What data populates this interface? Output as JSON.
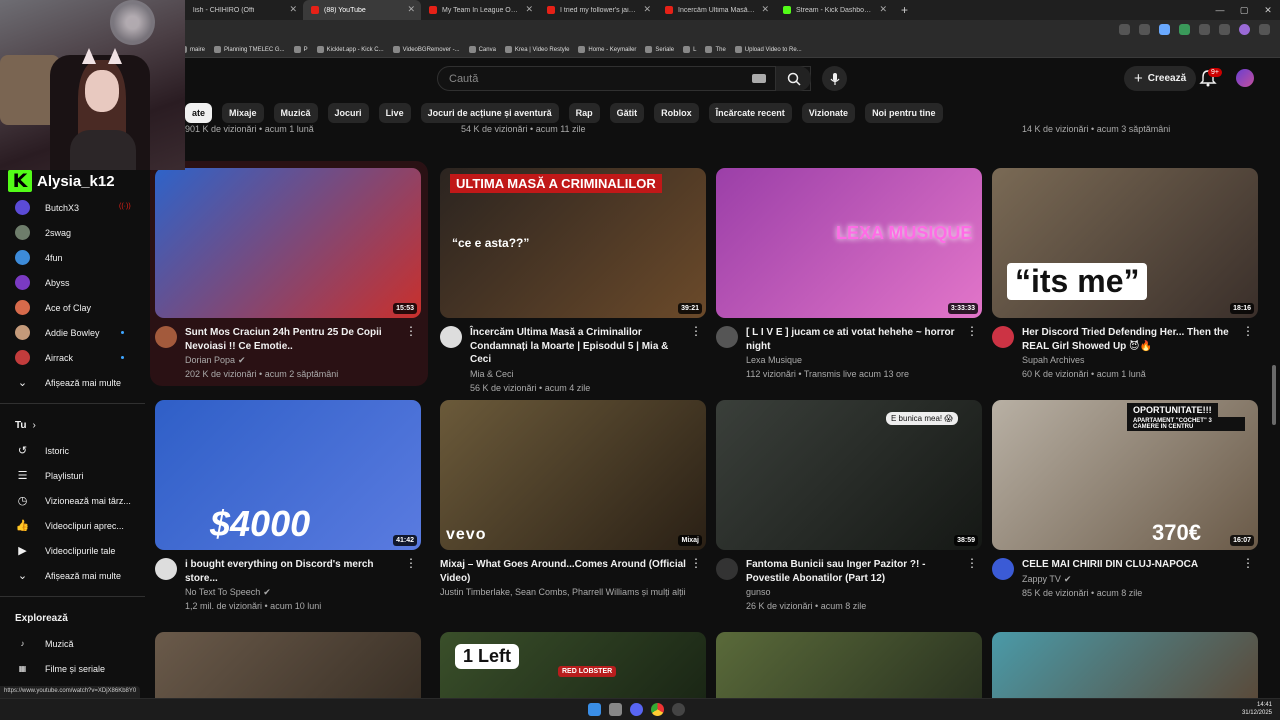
{
  "browser": {
    "tabs": [
      {
        "label": "lish - CHIHIRO (Offi",
        "active": false
      },
      {
        "label": "(88) YouTube",
        "active": true
      },
      {
        "label": "My Team In League Of Legends",
        "active": false
      },
      {
        "label": "I tried my follower's jail-worthy",
        "active": false
      },
      {
        "label": "Încercăm Ultima Masă a Crimin",
        "active": false
      },
      {
        "label": "Stream - Kick Dashboard",
        "active": false
      }
    ],
    "bookmarks": [
      "maire",
      "Planning TMELEC G...",
      "P",
      "Kicklet.app - Kick C...",
      "VideoBGRemover -...",
      "Canva",
      "Krea | Video Restyle",
      "Home - Keymailer",
      "Seriale",
      "L",
      "The",
      "Upload Video to Re..."
    ],
    "status_url": "https://www.youtube.com/watch?v=XDjX86Kb8Y0"
  },
  "overlay": {
    "streamer_name": "Alysia_k12",
    "kick_glyph": "K"
  },
  "header": {
    "search_placeholder": "Caută",
    "create_label": "Creează",
    "notif_count": "9+"
  },
  "chips": [
    "ate",
    "Mixaje",
    "Muzică",
    "Jocuri",
    "Live",
    "Jocuri de acțiune și aventură",
    "Rap",
    "Gătit",
    "Roblox",
    "Încărcate recent",
    "Vizionate",
    "Noi pentru tine"
  ],
  "sidebar": {
    "subscriptions": [
      {
        "name": "ButchX3",
        "color": "#5b4bd6",
        "live": "red"
      },
      {
        "name": "2swag",
        "color": "#6e7d6b",
        "live": ""
      },
      {
        "name": "4fun",
        "color": "#3d8bd9",
        "live": ""
      },
      {
        "name": "Abyss",
        "color": "#7a3ac2",
        "live": ""
      },
      {
        "name": "Ace of Clay",
        "color": "#d66a4b",
        "live": ""
      },
      {
        "name": "Addie Bowley",
        "color": "#c49a7a",
        "live": "blue"
      },
      {
        "name": "Airrack",
        "color": "#c23c3c",
        "live": "blue"
      }
    ],
    "show_more": "Afișează mai multe",
    "you_section": "Tu",
    "you_items": [
      {
        "label": "Istoric",
        "icon": "↺"
      },
      {
        "label": "Playlisturi",
        "icon": "☰"
      },
      {
        "label": "Vizionează mai târz...",
        "icon": "◷"
      },
      {
        "label": "Videoclipuri aprec...",
        "icon": "👍"
      },
      {
        "label": "Videoclipurile tale",
        "icon": "▶"
      }
    ],
    "show_more_2": "Afișează mai multe",
    "explore_section": "Explorează",
    "explore_items": [
      {
        "label": "Muzică",
        "icon": "♪"
      },
      {
        "label": "Filme și seriale",
        "icon": "▦"
      },
      {
        "label": "Live",
        "icon": "((·))"
      }
    ]
  },
  "top_strip": [
    "901 K de vizionări • acum 1 lună",
    "54 K de vizionări • acum 11 zile",
    "14 K de vizionări • acum 3 săptămâni"
  ],
  "videos": [
    {
      "title": "Sunt Mos Craciun 24h Pentru 25 De Copii Nevoiasi !! Ce Emotie..",
      "channel": "Dorian Popa",
      "stats": "202 K de vizionări • acum 2 săptămâni",
      "duration": "15:53",
      "verified": true,
      "thumb": [
        "#2e63c9",
        "#c9302c"
      ],
      "avatar": "#a35a3c"
    },
    {
      "title": "Încercăm Ultima Masă a Criminalilor Condamnați la Moarte | Episodul 5 | Mia & Ceci",
      "channel": "Mia & Ceci",
      "stats": "56 K de vizionări • acum 4 zile",
      "duration": "39:21",
      "thumb": [
        "#2b2420",
        "#6b4a2a"
      ],
      "avatar": "#ddd",
      "banner": "ULTIMA MASĂ A CRIMINALILOR",
      "quote": "“ce e asta??”"
    },
    {
      "title": "[ L I V E ] jucam ce ati votat hehehe ~ horror night",
      "channel": "Lexa Musique",
      "stats": "112 vizionări • Transmis live acum 13 ore",
      "duration": "3:33:33",
      "thumb": [
        "#9b3fa8",
        "#e275c9"
      ],
      "avatar": "#555",
      "overlay": "LEXA MUSIQUE"
    },
    {
      "title": "Her Discord Tried Defending Her... Then the REAL Girl Showed Up 😈🔥",
      "channel": "Supah Archives",
      "stats": "60 K de vizionări • acum 1 lună",
      "duration": "18:16",
      "thumb": [
        "#7a6a55",
        "#3a2f2a"
      ],
      "avatar": "#cc3344",
      "overlay": "“its me”"
    },
    {
      "title": "i bought everything on Discord's merch store...",
      "channel": "No Text To Speech",
      "stats": "1,2 mil. de vizionări • acum 10 luni",
      "duration": "41:42",
      "verified": true,
      "thumb": [
        "#2f5fc7",
        "#5a7be0"
      ],
      "avatar": "#ddd",
      "overlay": "$4000"
    },
    {
      "title": "Mixaj – What Goes Around...Comes Around (Official Video)",
      "channel": "Justin Timberlake, Sean Combs, Pharrell Williams și mulți alții",
      "stats": "",
      "duration": "Mixaj",
      "thumb": [
        "#6b5a3a",
        "#2a2015"
      ],
      "avatar": "",
      "overlay": "vevo"
    },
    {
      "title": "Fantoma Bunicii sau Inger Pazitor ?! - Povestile Abonatilor (Part 12)",
      "channel": "gunso",
      "stats": "26 K de vizionări • acum 8 zile",
      "duration": "38:59",
      "thumb": [
        "#3a3f3a",
        "#151815"
      ],
      "avatar": "#333",
      "overlay": "E bunica mea! 😱"
    },
    {
      "title": "CELE MAI CHIRII DIN CLUJ-NAPOCA",
      "channel": "Zappy TV",
      "stats": "85 K de vizionări • acum 8 zile",
      "duration": "16:07",
      "verified": true,
      "thumb": [
        "#b8b0a4",
        "#6a5a48"
      ],
      "avatar": "#3b5bd6",
      "overlay": "370€",
      "banner": "OPORTUNITATE!!!",
      "subbanner": "APARTAMENT \"COCHET\" 3 CAMERE IN CENTRU"
    }
  ],
  "row3": [
    {
      "thumb": [
        "#6a5a4a",
        "#3a3026"
      ]
    },
    {
      "thumb": [
        "#3a4f2a",
        "#1a2615"
      ],
      "overlay": "1 Left",
      "sign": "RED LOBSTER"
    },
    {
      "thumb": [
        "#5a6a3a",
        "#2a3320"
      ]
    },
    {
      "thumb": [
        "#4a9aa8",
        "#5a4a3a"
      ]
    }
  ],
  "clock": {
    "time": "14:41",
    "date": "31/12/2025"
  },
  "colors": {
    "accent": "#3ea6ff",
    "kick": "#53fc18",
    "bg": "#0f0f0f"
  }
}
